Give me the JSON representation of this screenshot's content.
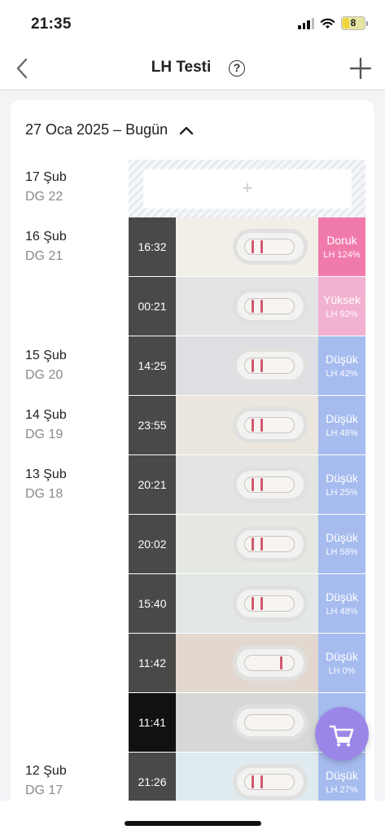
{
  "status": {
    "time": "21:35",
    "battery": "8"
  },
  "nav": {
    "title": "LH Testi",
    "help": "?"
  },
  "range": {
    "label": "27 Oca 2025 – Bugün"
  },
  "add_symbol": "+",
  "days": [
    {
      "date": "17 Şub",
      "dg": "DG 22"
    },
    {
      "date": "16 Şub",
      "dg": "DG 21"
    },
    {
      "date": "15 Şub",
      "dg": "DG 20"
    },
    {
      "date": "14 Şub",
      "dg": "DG 19"
    },
    {
      "date": "13 Şub",
      "dg": "DG 18"
    },
    {
      "date": "12 Şub",
      "dg": "DG 17"
    }
  ],
  "tests": [
    {
      "time": "16:32",
      "level": "Doruk",
      "lh": "LH 124%",
      "color": "#f07bab"
    },
    {
      "time": "00:21",
      "level": "Yüksek",
      "lh": "LH 92%",
      "color": "#f2b1d0"
    },
    {
      "time": "14:25",
      "level": "Düşük",
      "lh": "LH 42%",
      "color": "#a6bcef"
    },
    {
      "time": "23:55",
      "level": "Düşük",
      "lh": "LH 48%",
      "color": "#a6bcef"
    },
    {
      "time": "20:21",
      "level": "Düşük",
      "lh": "LH 25%",
      "color": "#a6bcef"
    },
    {
      "time": "20:02",
      "level": "Düşük",
      "lh": "LH 58%",
      "color": "#a6bcef"
    },
    {
      "time": "15:40",
      "level": "Düşük",
      "lh": "LH 48%",
      "color": "#a6bcef"
    },
    {
      "time": "11:42",
      "level": "Düşük",
      "lh": "LH 0%",
      "color": "#a6bcef"
    },
    {
      "time": "11:41",
      "level": "",
      "lh": "",
      "color": "#a6bcef"
    },
    {
      "time": "21:26",
      "level": "Düşük",
      "lh": "LH 27%",
      "color": "#a6bcef"
    }
  ]
}
